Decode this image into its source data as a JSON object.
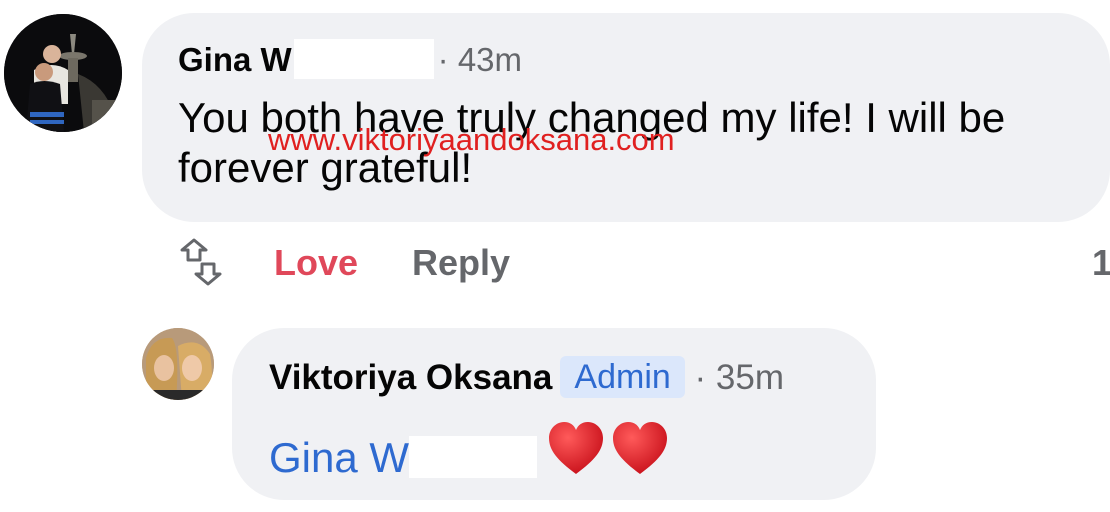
{
  "main_comment": {
    "author": "Gina W",
    "time": "· 43m",
    "text": "You both have truly changed my life! I will be forever grateful!"
  },
  "watermark": "www.viktoriyaandoksana.com",
  "actions": {
    "react_icon": "reaction-swap-icon",
    "love_label": "Love",
    "reply_label": "Reply",
    "count": "1"
  },
  "reply_comment": {
    "author": "Viktoriya Oksana",
    "badge": "Admin",
    "time": "· 35m",
    "mention": "Gina W",
    "hearts_icon": "red-heart-icon"
  },
  "colors": {
    "bubble": "#f0f1f4",
    "love": "#e0485a",
    "link": "#2e6ad0",
    "badge_bg": "#dbe7fb",
    "watermark": "#e02020",
    "muted": "#65676b"
  }
}
